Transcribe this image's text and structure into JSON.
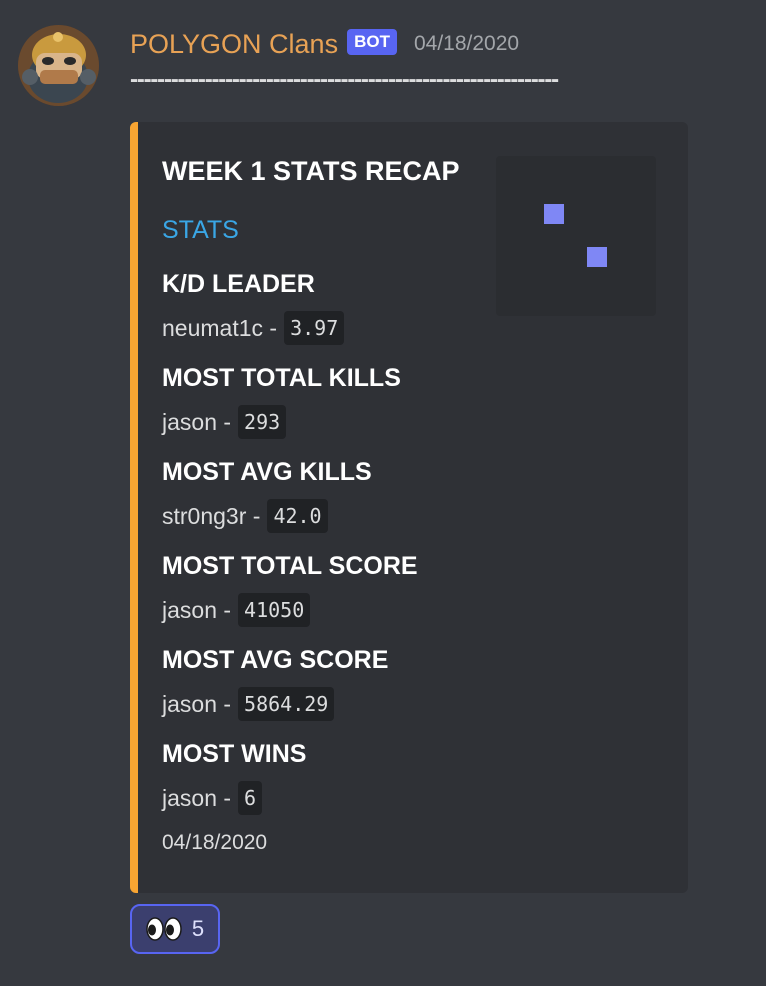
{
  "author": {
    "name": "POLYGON Clans",
    "badge": "BOT",
    "timestamp": "04/18/2020",
    "avatar_icon": "helmeted-character-avatar"
  },
  "message": {
    "separator": "---------------------------------------------------------------"
  },
  "embed": {
    "accent_color": "#f8a532",
    "title": "WEEK 1 STATS RECAP",
    "description": "STATS",
    "thumbnail_icon": "pixel-squares-thumbnail",
    "fields": [
      {
        "name": "K/D LEADER",
        "player": "neumat1c",
        "separator": "-",
        "value": "3.97"
      },
      {
        "name": "MOST TOTAL KILLS",
        "player": "jason",
        "separator": "-",
        "value": "293"
      },
      {
        "name": "MOST AVG KILLS",
        "player": "str0ng3r",
        "separator": "-",
        "value": "42.0"
      },
      {
        "name": "MOST TOTAL SCORE",
        "player": "jason",
        "separator": "-",
        "value": "41050"
      },
      {
        "name": "MOST AVG SCORE",
        "player": "jason",
        "separator": "-",
        "value": "5864.29"
      },
      {
        "name": "MOST WINS",
        "player": "jason",
        "separator": "-",
        "value": "6"
      }
    ],
    "footer": "04/18/2020"
  },
  "reaction": {
    "emoji": "eyes-emoji",
    "count": "5"
  },
  "colors": {
    "background": "#36393f",
    "embed_background": "#2f3136",
    "username": "#e8a255",
    "bot_badge": "#5865f2",
    "link": "#3aa6e5"
  }
}
